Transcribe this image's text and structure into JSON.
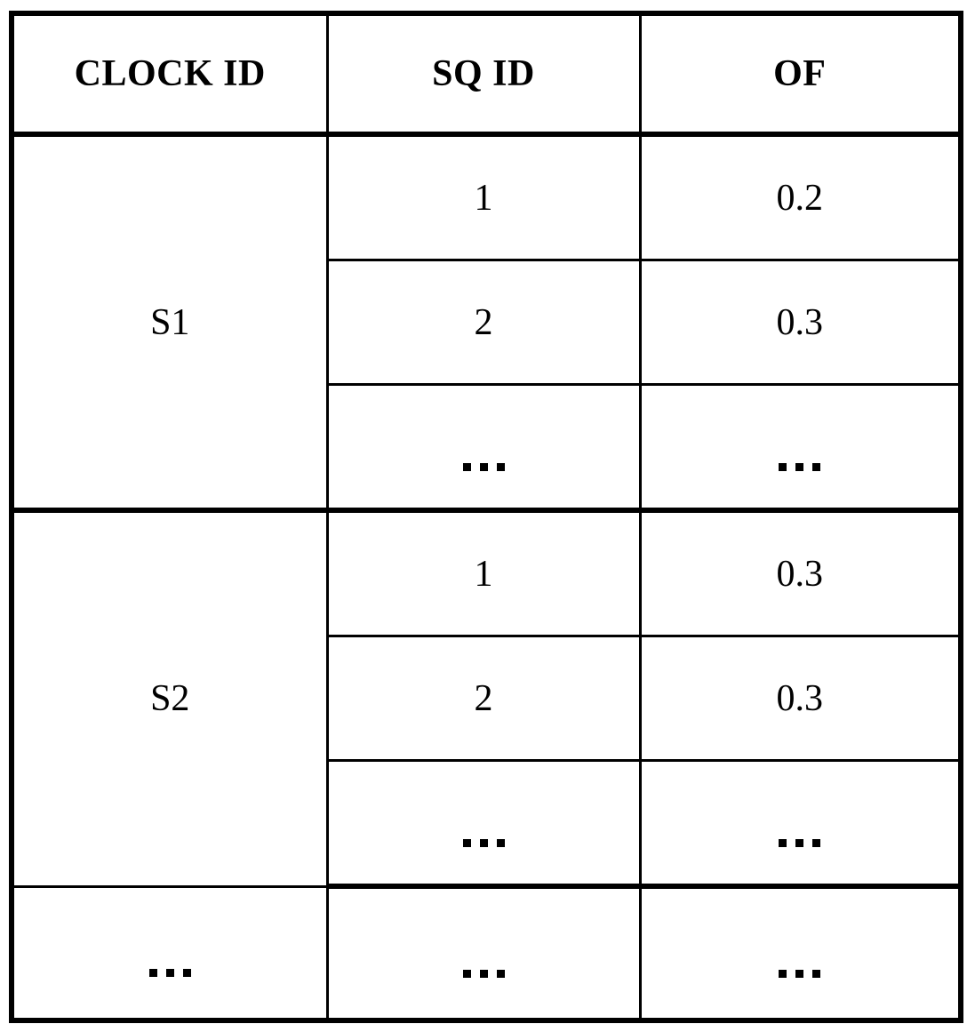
{
  "table": {
    "columns": [
      {
        "key": "clock_id",
        "label": "CLOCK ID"
      },
      {
        "key": "sq_id",
        "label": "SQ ID"
      },
      {
        "key": "of",
        "label": "OF"
      }
    ],
    "ellipsis": "...",
    "groups": [
      {
        "clock_id": "S1",
        "rows": [
          {
            "sq_id": "1",
            "of": "0.2"
          },
          {
            "sq_id": "2",
            "of": "0.3"
          },
          {
            "sq_id": "...",
            "of": "..."
          }
        ]
      },
      {
        "clock_id": "S2",
        "rows": [
          {
            "sq_id": "1",
            "of": "0.3"
          },
          {
            "sq_id": "2",
            "of": "0.3"
          },
          {
            "sq_id": "...",
            "of": "..."
          }
        ]
      }
    ],
    "final_row": {
      "clock_id": "...",
      "sq_id": "...",
      "of": "..."
    },
    "colors": {
      "border": "#000000",
      "text": "#000000",
      "background": "#ffffff"
    }
  }
}
